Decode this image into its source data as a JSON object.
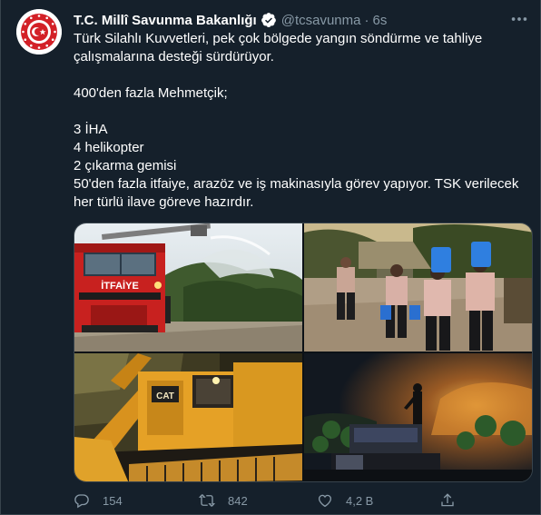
{
  "account": {
    "name": "T.C. Millî Savunma Bakanlığı",
    "handle": "@tcsavunma",
    "separator": "·",
    "time": "6s"
  },
  "tweet": {
    "lines": [
      "Türk Silahlı Kuvvetleri, pek çok bölgede yangın söndürme ve tahliye çalışmalarına desteği sürdürüyor.",
      "",
      "400'den fazla Mehmetçik;",
      "",
      "3 İHA",
      "4 helikopter",
      "2 çıkarma gemisi",
      "50'den fazla itfaiye, arazöz ve iş makinasıyla görev yapıyor. TSK verilecek her türlü ilave göreve hazırdır."
    ],
    "truck_label": "İTFAİYE",
    "dozer_label": "CAT"
  },
  "actions": {
    "replies": "154",
    "retweets": "842",
    "likes": "4,2 B"
  },
  "colors": {
    "background": "#15202b",
    "text": "#ffffff",
    "secondary": "#8899a6",
    "accent": "#1d9bf0"
  },
  "icons": [
    "verified-badge-icon",
    "more-options-icon",
    "reply-icon",
    "retweet-icon",
    "like-icon",
    "share-icon"
  ]
}
